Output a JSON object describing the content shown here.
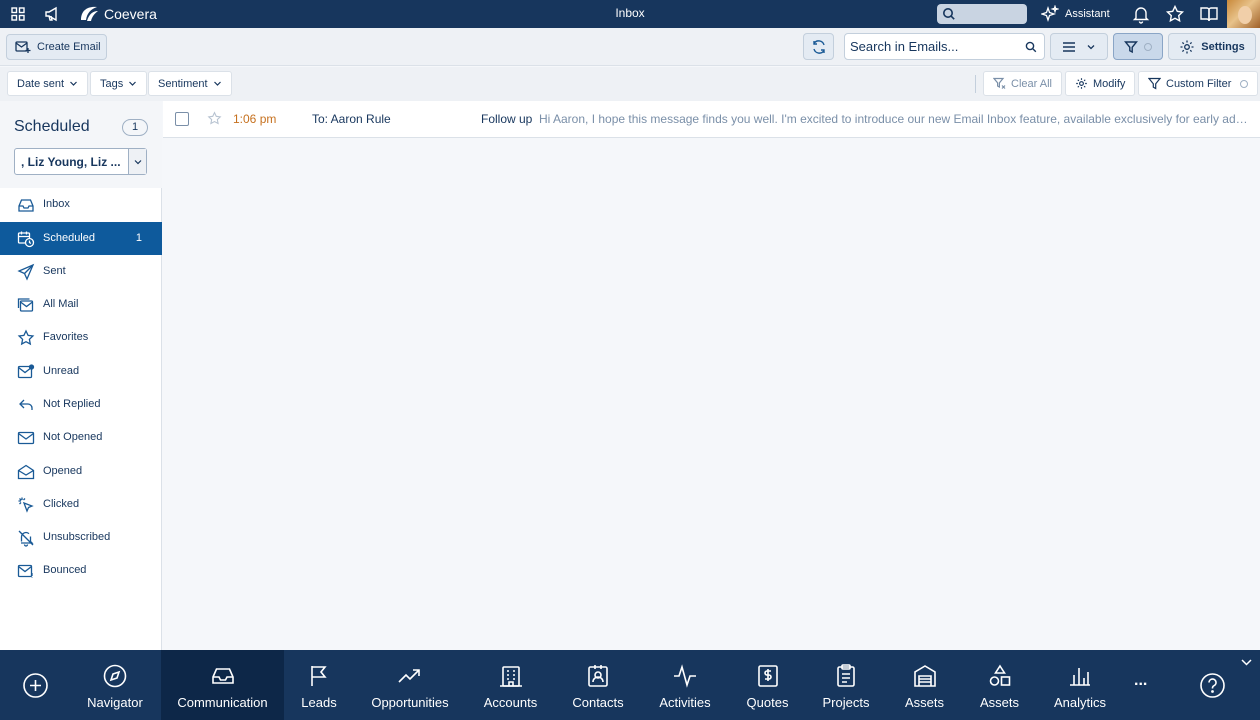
{
  "topbar": {
    "brand": "Coevera",
    "title": "Inbox",
    "assistant_label": "Assistant",
    "icons": [
      "apps-grid-icon",
      "megaphone-icon",
      "search-icon",
      "sparkle-icon",
      "bell-icon",
      "star-icon",
      "book-icon"
    ]
  },
  "toolbar": {
    "create_email_label": "Create Email",
    "search_placeholder": "Search in Emails...",
    "settings_label": "Settings"
  },
  "filters": {
    "date_sent": "Date sent",
    "tags": "Tags",
    "sentiment": "Sentiment",
    "clear_all": "Clear All",
    "modify": "Modify",
    "custom_filter": "Custom Filter"
  },
  "sidebar": {
    "title": "Scheduled",
    "count": "1",
    "mailbox_select": ", Liz Young, Liz ...",
    "items": [
      {
        "label": "Inbox",
        "icon": "inbox-icon"
      },
      {
        "label": "Scheduled",
        "icon": "calendar-clock-icon",
        "badge": "1",
        "active": true
      },
      {
        "label": "Sent",
        "icon": "send-icon"
      },
      {
        "label": "All Mail",
        "icon": "all-mail-icon"
      },
      {
        "label": "Favorites",
        "icon": "star-icon"
      },
      {
        "label": "Unread",
        "icon": "mail-unread-icon"
      },
      {
        "label": "Not Replied",
        "icon": "reply-icon"
      },
      {
        "label": "Not Opened",
        "icon": "mail-icon"
      },
      {
        "label": "Opened",
        "icon": "mail-open-icon"
      },
      {
        "label": "Clicked",
        "icon": "cursor-click-icon"
      },
      {
        "label": "Unsubscribed",
        "icon": "bell-off-icon"
      },
      {
        "label": "Bounced",
        "icon": "mail-bounced-icon"
      }
    ]
  },
  "emails": [
    {
      "time": "1:06 pm",
      "to": "To: Aaron Rule",
      "subject": "Follow up",
      "preview": "Hi Aaron, I hope this message finds you well. I'm excited to introduce our new Email Inbox feature, available exclusively for early adopters."
    }
  ],
  "bottom_nav": {
    "items": [
      {
        "label": "Navigator",
        "icon": "compass-icon"
      },
      {
        "label": "Communication",
        "icon": "inbox-tray-icon",
        "active": true
      },
      {
        "label": "Leads",
        "icon": "flag-icon"
      },
      {
        "label": "Opportunities",
        "icon": "trending-up-icon"
      },
      {
        "label": "Accounts",
        "icon": "building-icon"
      },
      {
        "label": "Contacts",
        "icon": "contact-card-icon"
      },
      {
        "label": "Activities",
        "icon": "activity-pulse-icon"
      },
      {
        "label": "Quotes",
        "icon": "dollar-document-icon"
      },
      {
        "label": "Projects",
        "icon": "clipboard-icon"
      },
      {
        "label": "Assets",
        "icon": "warehouse-icon"
      },
      {
        "label": "Assets",
        "icon": "shapes-icon"
      },
      {
        "label": "Analytics",
        "icon": "bar-chart-icon"
      }
    ],
    "more_label": "..."
  }
}
